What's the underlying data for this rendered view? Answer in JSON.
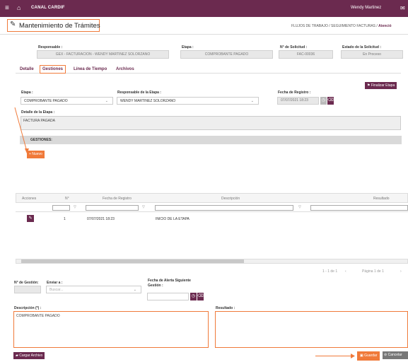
{
  "topbar": {
    "menu_icon": "hamburger-icon",
    "home_icon": "home-icon",
    "brand": "CANAL CARDIF",
    "user": "Wendy Martinez",
    "mail_icon": "mail-icon",
    "bg_color": "#6b2a4f"
  },
  "page": {
    "title": "Mantenimiento de Trámites",
    "breadcrumb_path": "FLUJOS DE TRABAJO / SEGUIMIENTO FACTURAS / ",
    "breadcrumb_current": "Atenció"
  },
  "header_fields": {
    "responsable_label": "Responsable :",
    "responsable_value": "GEX - FACTURACION - WENDY MARTINEZ SOLORZANO",
    "etapa_label": "Etapa :",
    "etapa_value": "COMPROBANTE PAGADO",
    "solicitud_label": "N° de Solicitud :",
    "solicitud_value": "FAC-00036",
    "estado_label": "Estado de la Solicitud :",
    "estado_value": "En Proceso"
  },
  "tabs": [
    {
      "label": "Detalle"
    },
    {
      "label": "Gestiones"
    },
    {
      "label": "Línea de Tiempo"
    },
    {
      "label": "Archivos"
    }
  ],
  "actions": {
    "finalizar": "Finalizar Etapa",
    "nuevo": "+ Nuevo",
    "cargar": "Cargar Archivo",
    "guardar": "Guardar",
    "cancelar": "Cancelar"
  },
  "etapa_form": {
    "etapa_label": "Etapa :",
    "etapa_value": "COMPROBANTE PAGADO",
    "resp_label": "Responsable de la Etapa :",
    "resp_value": "WENDY MARTINEZ SOLORZANO",
    "fecha_label": "Fecha de Registro :",
    "fecha_value": "07/07/2021 18:23",
    "detalle_label": "Detalle de la Etapa :",
    "detalle_value": "FACTURA PAGADA"
  },
  "gestiones": {
    "section_title": "GESTIONES:",
    "columns": [
      "Acciones",
      "N°",
      "Fecha de Registro",
      "Descripción",
      "Resultado"
    ],
    "rows": [
      {
        "num": "1",
        "fecha": "07/07/2021 18:23",
        "descripcion": "INICIO DE LA ETAPA",
        "resultado": ""
      }
    ],
    "pager_count": "1 - 1 de 1",
    "pager_page": "Página 1 de 1"
  },
  "gestion_form": {
    "num_label": "N° de Gestión:",
    "enviar_label": "Enviar a :",
    "enviar_placeholder": "Buscar...",
    "alerta_label_1": "Fecha de Alerta Siguiente",
    "alerta_label_2": "Gestión :",
    "descripcion_label": "Descripción (*) :",
    "descripcion_value": "COMPROBANTE PAGADO",
    "resultado_label": "Resultado :",
    "resultado_value": ""
  },
  "colors": {
    "accent": "#6b2a4f",
    "highlight": "#f07a3a"
  }
}
